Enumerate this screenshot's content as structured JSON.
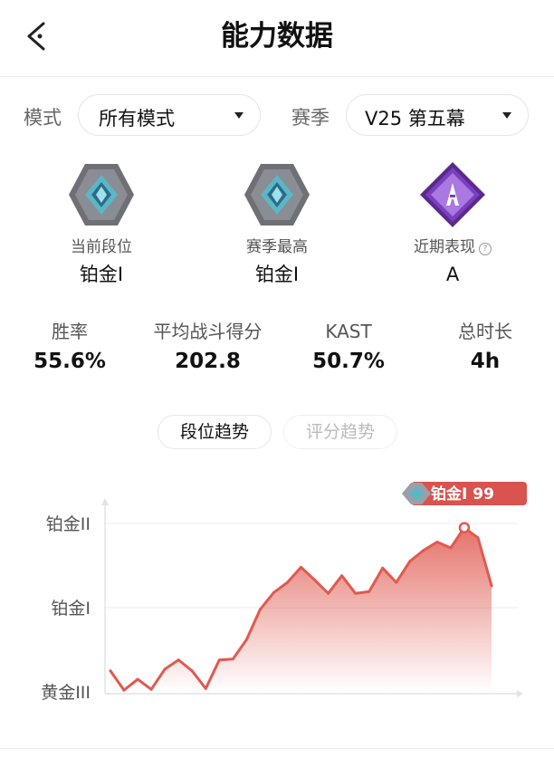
{
  "header": {
    "title": "能力数据",
    "back_icon": "chevron-left-icon"
  },
  "filters": {
    "mode_label": "模式",
    "mode_value": "所有模式",
    "season_label": "赛季",
    "season_value": "V25 第五幕"
  },
  "ranks": [
    {
      "label": "当前段位",
      "value": "铂金I",
      "icon": "platinum-rank-icon"
    },
    {
      "label": "赛季最高",
      "value": "铂金I",
      "icon": "platinum-rank-icon"
    },
    {
      "label": "近期表现",
      "value": "A",
      "icon": "grade-a-icon",
      "has_help": true,
      "help_glyph": "?"
    }
  ],
  "stats": [
    {
      "label": "胜率",
      "value": "55.6%"
    },
    {
      "label": "平均战斗得分",
      "value": "202.8"
    },
    {
      "label": "KAST",
      "value": "50.7%"
    },
    {
      "label": "总时长",
      "value": "4h"
    }
  ],
  "tabs": [
    {
      "label": "段位趋势",
      "active": true
    },
    {
      "label": "评分趋势",
      "active": false
    }
  ],
  "colors": {
    "accent": "#e05a50",
    "badge_bg": "#d9534f",
    "grid": "#ececec",
    "platinum": "#5bb6c8",
    "grade_purple": "#7a3fbf"
  },
  "chart_data": {
    "type": "area",
    "y_tick_labels": [
      "黄金III",
      "铂金I",
      "铂金II"
    ],
    "ylim": [
      0,
      2
    ],
    "peak_label": "铂金I 99",
    "values": [
      0.25,
      0.02,
      0.15,
      0.03,
      0.27,
      0.38,
      0.25,
      0.04,
      0.38,
      0.39,
      0.62,
      0.98,
      1.18,
      1.3,
      1.48,
      1.33,
      1.17,
      1.38,
      1.17,
      1.19,
      1.47,
      1.3,
      1.55,
      1.68,
      1.78,
      1.71,
      1.95,
      1.83,
      1.26
    ]
  }
}
